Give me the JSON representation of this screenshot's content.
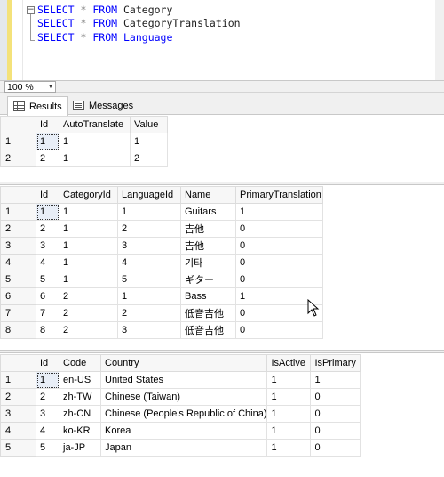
{
  "editor": {
    "lines": [
      {
        "kw1": "SELECT",
        "op": "*",
        "kw2": "FROM",
        "table": "Category"
      },
      {
        "kw1": "SELECT",
        "op": "*",
        "kw2": "FROM",
        "table": "CategoryTranslation"
      },
      {
        "kw1": "SELECT",
        "op": "*",
        "kw2": "FROM",
        "table": "Language"
      }
    ],
    "collapse_glyph": "−"
  },
  "zoom": {
    "value": "100 %",
    "arrow": "▼"
  },
  "tabs": [
    {
      "label": "Results",
      "icon": "grid-icon",
      "active": true
    },
    {
      "label": "Messages",
      "icon": "messages-icon",
      "active": false
    }
  ],
  "grid1": {
    "columns": [
      "Id",
      "AutoTranslate",
      "Value"
    ],
    "rows": [
      {
        "n": "1",
        "cells": [
          "1",
          "1",
          "1"
        ]
      },
      {
        "n": "2",
        "cells": [
          "2",
          "1",
          "2"
        ]
      }
    ]
  },
  "grid2": {
    "columns": [
      "Id",
      "CategoryId",
      "LanguageId",
      "Name",
      "PrimaryTranslation"
    ],
    "rows": [
      {
        "n": "1",
        "cells": [
          "1",
          "1",
          "1",
          "Guitars",
          "1"
        ]
      },
      {
        "n": "2",
        "cells": [
          "2",
          "1",
          "2",
          "吉他",
          "0"
        ]
      },
      {
        "n": "3",
        "cells": [
          "3",
          "1",
          "3",
          "吉他",
          "0"
        ]
      },
      {
        "n": "4",
        "cells": [
          "4",
          "1",
          "4",
          "기타",
          "0"
        ]
      },
      {
        "n": "5",
        "cells": [
          "5",
          "1",
          "5",
          "ギター",
          "0"
        ]
      },
      {
        "n": "6",
        "cells": [
          "6",
          "2",
          "1",
          "Bass",
          "1"
        ]
      },
      {
        "n": "7",
        "cells": [
          "7",
          "2",
          "2",
          "低音吉他",
          "0"
        ]
      },
      {
        "n": "8",
        "cells": [
          "8",
          "2",
          "3",
          "低音吉他",
          "0"
        ]
      }
    ]
  },
  "grid3": {
    "columns": [
      "Id",
      "Code",
      "Country",
      "IsActive",
      "IsPrimary"
    ],
    "rows": [
      {
        "n": "1",
        "cells": [
          "1",
          "en-US",
          "United States",
          "1",
          "1"
        ]
      },
      {
        "n": "2",
        "cells": [
          "2",
          "zh-TW",
          "Chinese (Taiwan)",
          "1",
          "0"
        ]
      },
      {
        "n": "3",
        "cells": [
          "3",
          "zh-CN",
          "Chinese (People's Republic of China)",
          "1",
          "0"
        ]
      },
      {
        "n": "4",
        "cells": [
          "4",
          "ko-KR",
          "Korea",
          "1",
          "0"
        ]
      },
      {
        "n": "5",
        "cells": [
          "5",
          "ja-JP",
          "Japan",
          "1",
          "0"
        ]
      }
    ]
  }
}
